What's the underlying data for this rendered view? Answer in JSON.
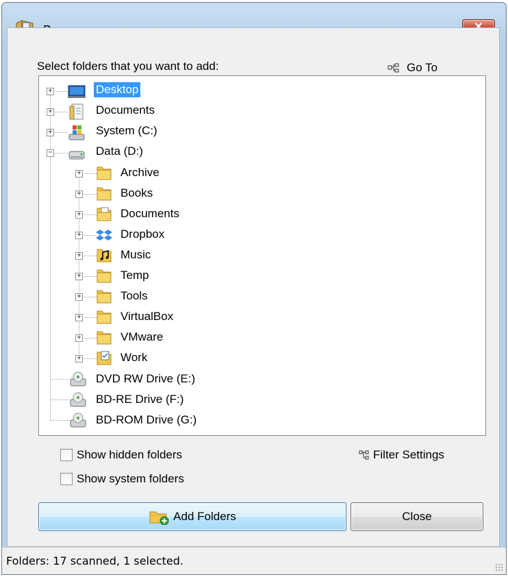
{
  "window": {
    "title": "Browse",
    "close_glyph": "✕"
  },
  "prompt": "Select folders that you want to add:",
  "goto_label": "Go To",
  "tree": {
    "root_nodes": [
      {
        "label": "Desktop",
        "icon": "desktop-icon",
        "expander": "+",
        "selected": true
      },
      {
        "label": "Documents",
        "icon": "documents-library-icon",
        "expander": "+"
      },
      {
        "label": "System (C:)",
        "icon": "windows-drive-icon",
        "expander": "+"
      },
      {
        "label": "Data (D:)",
        "icon": "hard-drive-icon",
        "expander": "−"
      }
    ],
    "data_children": [
      {
        "label": "Archive",
        "icon": "folder-icon"
      },
      {
        "label": "Books",
        "icon": "folder-icon"
      },
      {
        "label": "Documents",
        "icon": "documents-folder-icon"
      },
      {
        "label": "Dropbox",
        "icon": "dropbox-icon"
      },
      {
        "label": "Music",
        "icon": "music-folder-icon"
      },
      {
        "label": "Temp",
        "icon": "folder-icon"
      },
      {
        "label": "Tools",
        "icon": "folder-icon"
      },
      {
        "label": "VirtualBox",
        "icon": "folder-icon"
      },
      {
        "label": "VMware",
        "icon": "folder-icon"
      },
      {
        "label": "Work",
        "icon": "work-folder-icon"
      }
    ],
    "drives": [
      {
        "label": "DVD RW Drive (E:)",
        "icon": "optical-drive-icon"
      },
      {
        "label": "BD-RE Drive (F:)",
        "icon": "optical-drive-icon"
      },
      {
        "label": "BD-ROM Drive (G:)",
        "icon": "optical-drive-icon"
      }
    ]
  },
  "options": {
    "show_hidden": "Show hidden folders",
    "show_system": "Show system folders",
    "filter_settings": "Filter Settings"
  },
  "buttons": {
    "add": "Add Folders",
    "close": "Close"
  },
  "status": "Folders: 17 scanned, 1 selected.",
  "colors": {
    "selection": "#3399ff",
    "client_bg": "#f0f0f0",
    "title_gradient": "#c9dff2"
  }
}
